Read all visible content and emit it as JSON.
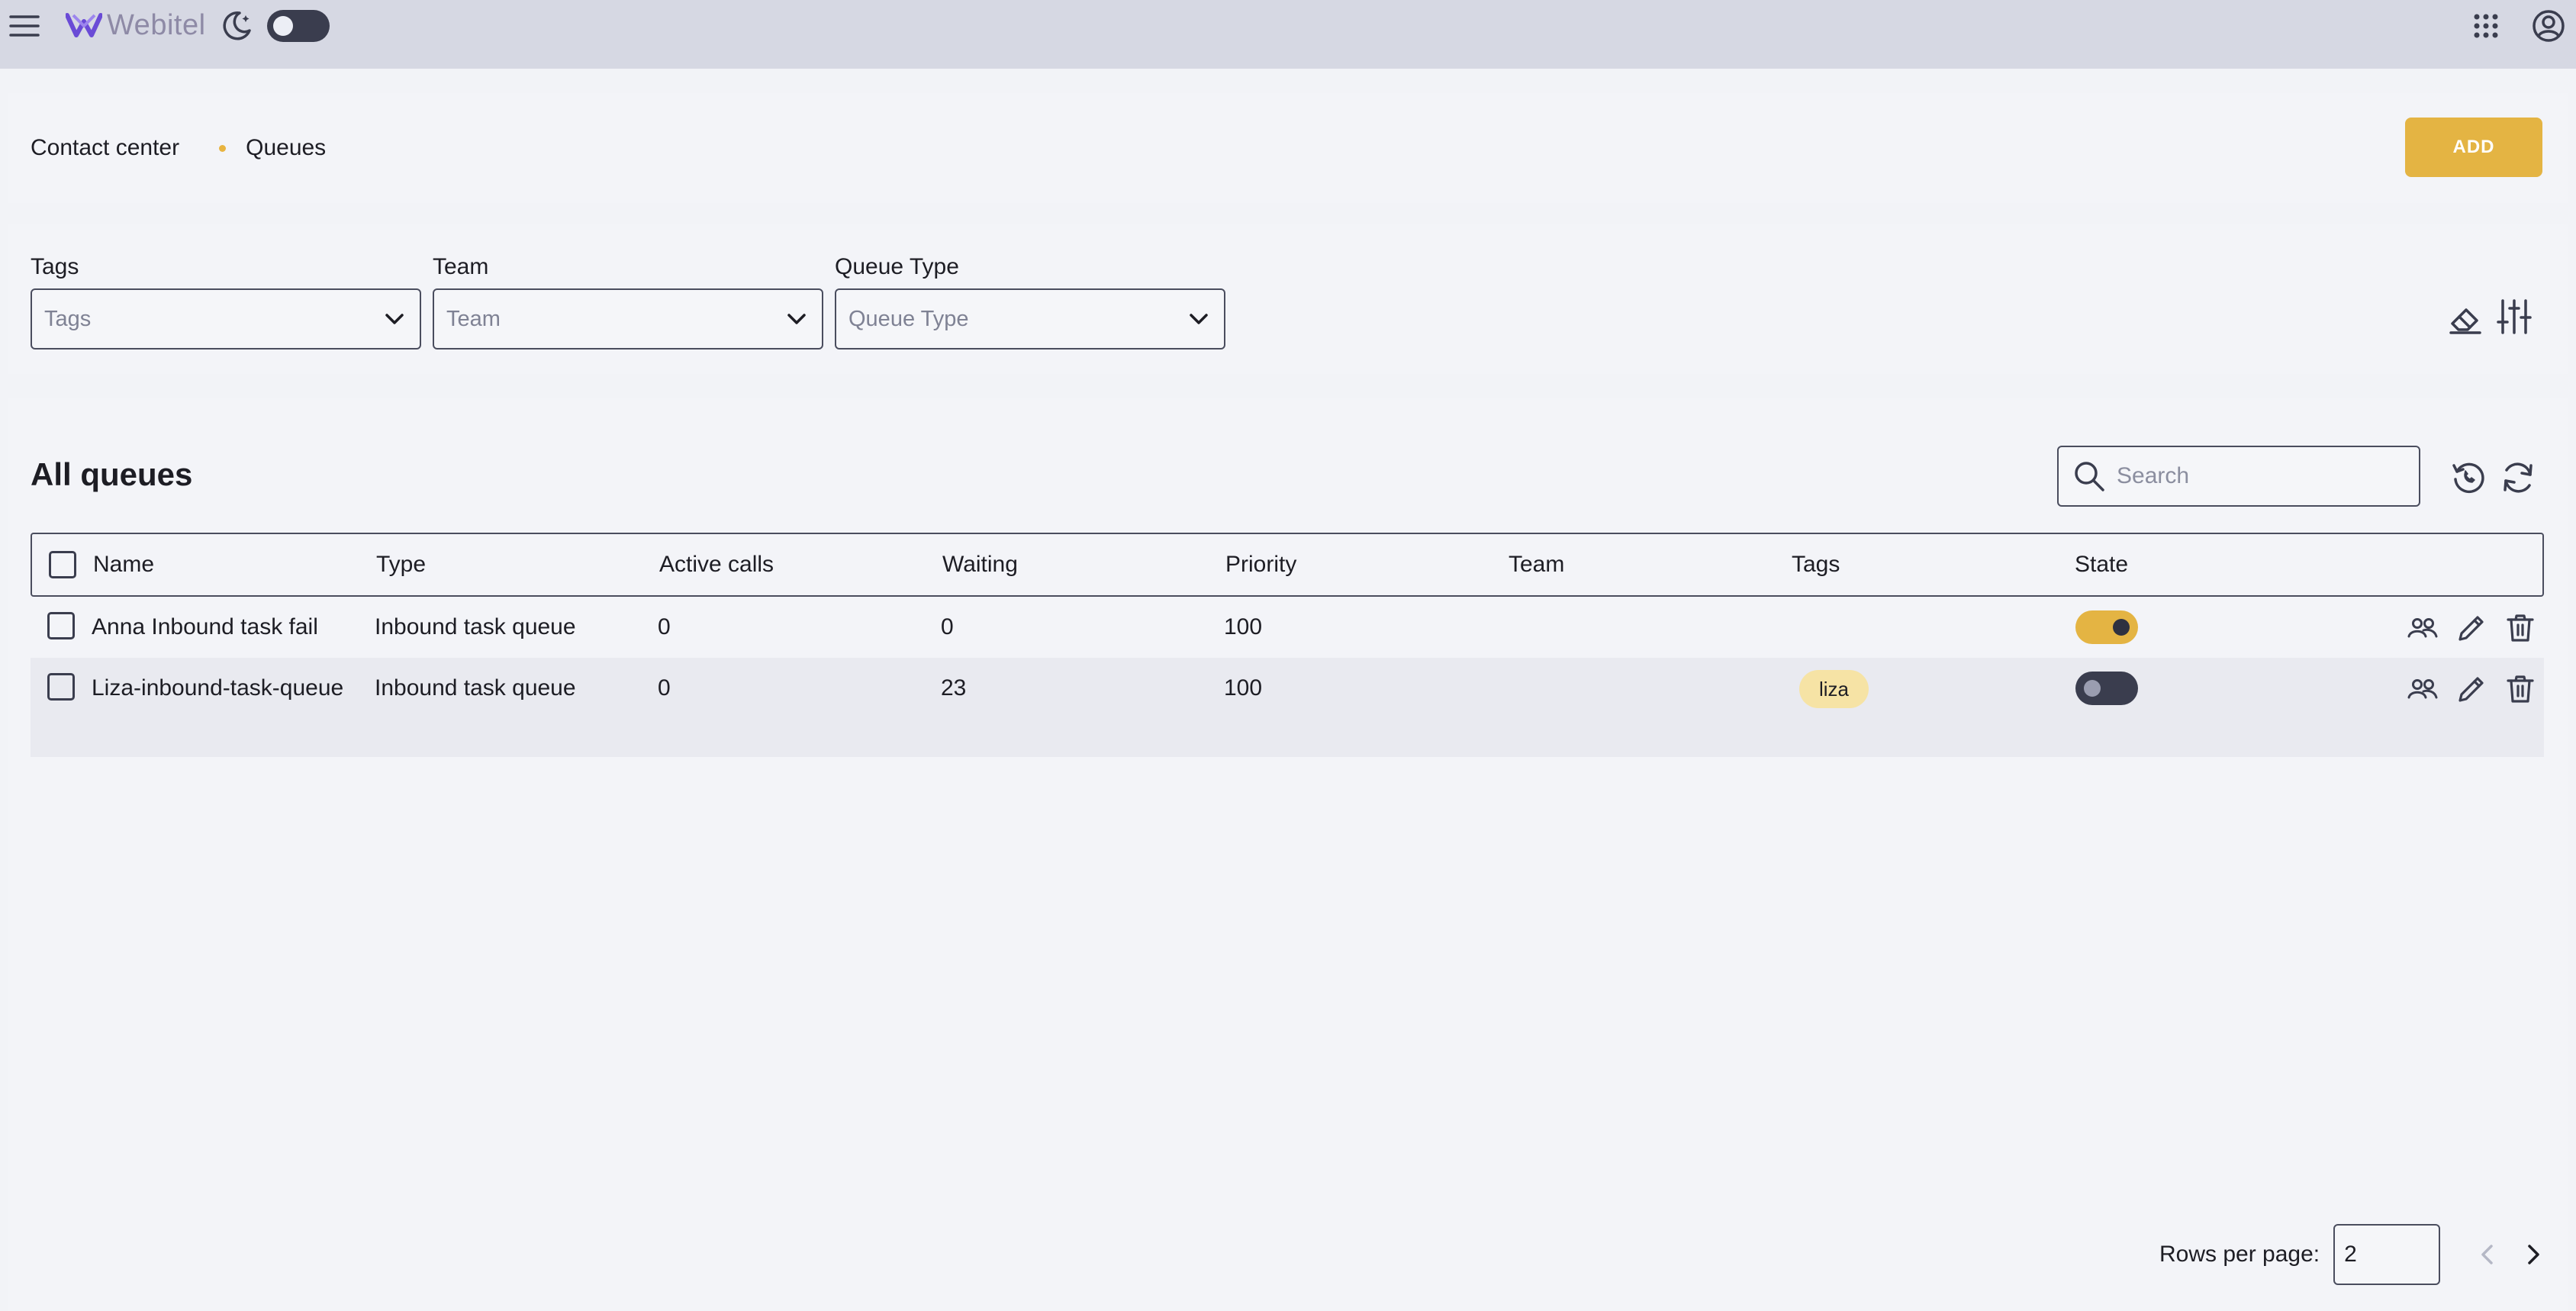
{
  "app": {
    "logo_text": "Webitel",
    "brand_color": "#6a4bd6",
    "accent_color": "#e4b443"
  },
  "topbar": {
    "menu_icon": "hamburger-menu-icon",
    "theme_icon": "moon-icon",
    "theme_dark_mode": false,
    "apps_icon": "apps-grid-icon",
    "account_icon": "account-circle-icon"
  },
  "header": {
    "breadcrumb": [
      "Contact center",
      "Queues"
    ],
    "add_label": "ADD"
  },
  "filters": {
    "items": [
      {
        "label": "Tags",
        "placeholder": "Tags"
      },
      {
        "label": "Team",
        "placeholder": "Team"
      },
      {
        "label": "Queue Type",
        "placeholder": "Queue Type"
      }
    ],
    "clear_icon": "eraser-icon",
    "settings_icon": "sliders-icon"
  },
  "table_section": {
    "title": "All queues",
    "search_placeholder": "Search",
    "columns": [
      "Name",
      "Type",
      "Active calls",
      "Waiting",
      "Priority",
      "Team",
      "Tags",
      "State"
    ],
    "rows": [
      {
        "name": "Anna Inbound task fail",
        "type": "Inbound task queue",
        "active_calls": "0",
        "waiting": "0",
        "priority": "100",
        "team": "",
        "tags": [],
        "state": true
      },
      {
        "name": "Liza-inbound-task-queue",
        "type": "Inbound task queue",
        "active_calls": "0",
        "waiting": "23",
        "priority": "100",
        "team": "",
        "tags": [
          "liza"
        ],
        "state": false
      }
    ],
    "row_actions": [
      "members-icon",
      "edit-pencil-icon",
      "delete-trash-icon"
    ]
  },
  "pagination": {
    "rows_per_page_label": "Rows per page:",
    "rows_per_page_value": "2"
  }
}
